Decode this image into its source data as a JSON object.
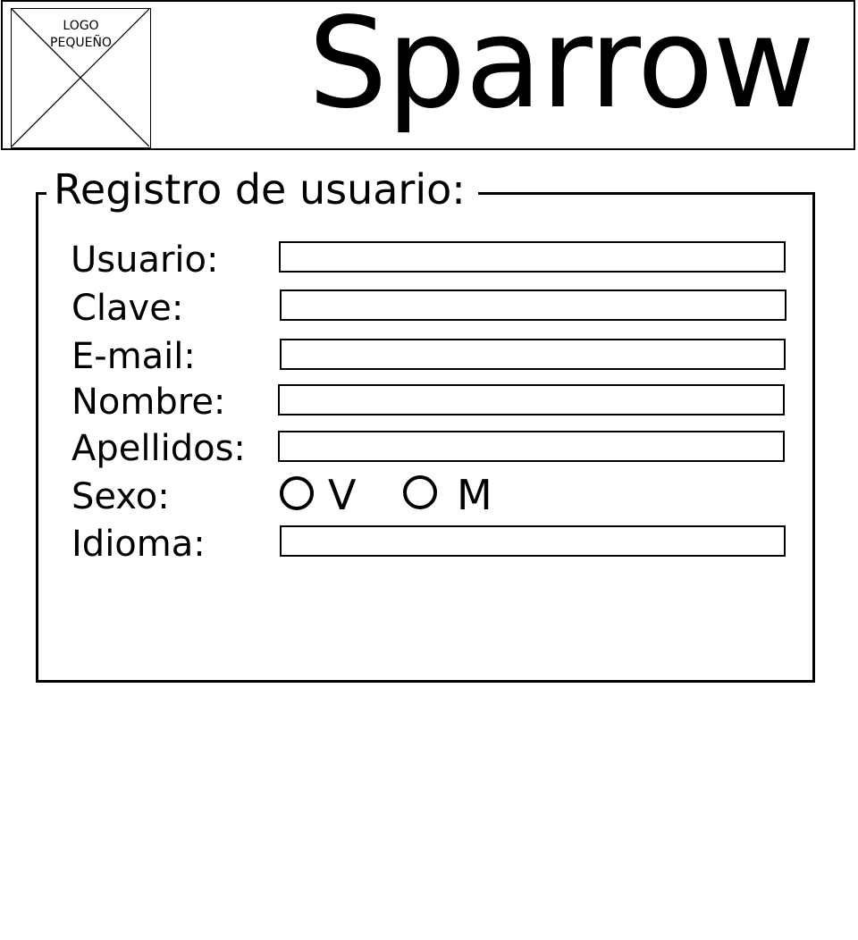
{
  "header": {
    "logo": {
      "line1": "LOGO",
      "line2": "PEQUEÑO",
      "icon": "placeholder-x-icon"
    },
    "brand": "Sparrow"
  },
  "form": {
    "legend": "Registro de usuario:",
    "fields": {
      "usuario": {
        "label": "Usuario:",
        "value": ""
      },
      "clave": {
        "label": "Clave:",
        "value": ""
      },
      "email": {
        "label": "E-mail:",
        "value": ""
      },
      "nombre": {
        "label": "Nombre:",
        "value": ""
      },
      "apellidos": {
        "label": "Apellidos:",
        "value": ""
      },
      "idioma": {
        "label": "Idioma:",
        "value": ""
      }
    },
    "sexo": {
      "label": "Sexo:",
      "options": [
        {
          "label": "V",
          "selected": false
        },
        {
          "label": "M",
          "selected": false
        }
      ]
    }
  }
}
